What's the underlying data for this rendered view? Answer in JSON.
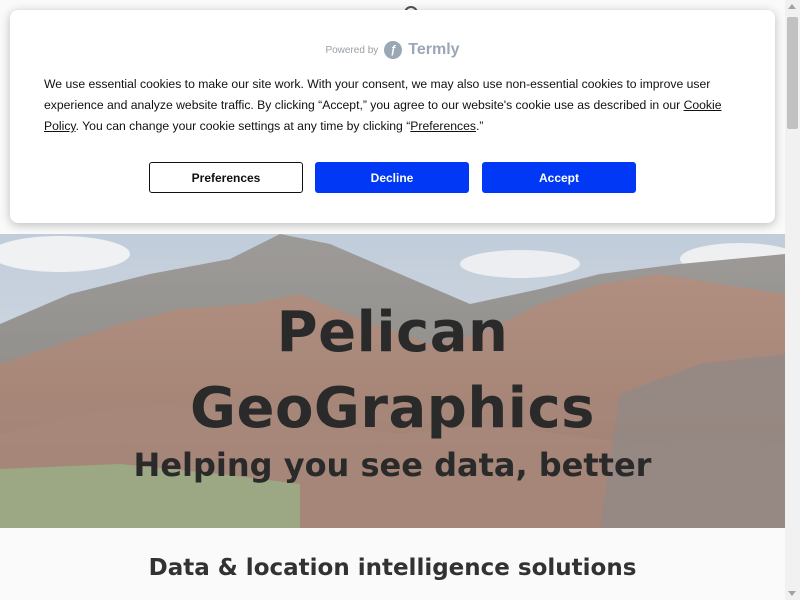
{
  "colors": {
    "accent_blue": "#0038f5",
    "hero_text": "#2b2b2b",
    "banner_bg": "#ffffff"
  },
  "hero": {
    "title_line1": "Pelican",
    "title_line2": "GeoGraphics",
    "subtitle": "Helping you see data, better"
  },
  "section": {
    "heading": "Data & location intelligence solutions"
  },
  "cookie_banner": {
    "powered_by": "Powered by",
    "brand": "Termly",
    "text_part1": "We use essential cookies to make our site work. With your consent, we may also use non-essential cookies to improve user experience and analyze website traffic. By clicking “Accept,” you agree to our website's cookie use as described in our ",
    "cookie_policy_link": "Cookie Policy",
    "text_part2": ". You can change your cookie settings at any time by clicking “",
    "preferences_link": "Preferences",
    "text_part3": ".”",
    "buttons": {
      "preferences": "Preferences",
      "decline": "Decline",
      "accept": "Accept"
    }
  }
}
